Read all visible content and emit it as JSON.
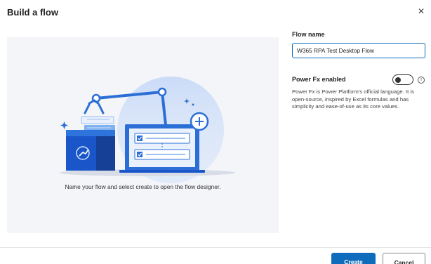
{
  "dialog": {
    "title": "Build a flow",
    "close_icon": "close-icon"
  },
  "illustration": {
    "caption": "Name your flow and select create to open the flow designer.",
    "icons": [
      "robot-arm-icon",
      "flow-box-icon",
      "laptop-icon",
      "plus-circle-icon",
      "sparkle-icon"
    ]
  },
  "form": {
    "flow_name_label": "Flow name",
    "flow_name_value": "W365 RPA Test Desktop Flow",
    "power_fx_label": "Power Fx enabled",
    "power_fx_enabled": false,
    "info_icon": "info-icon",
    "power_fx_description": "Power Fx is Power Platform's official language. It is open-source, inspired by Excel formulas and has simplicity and ease-of-use as its core values."
  },
  "footer": {
    "create_label": "Create",
    "cancel_label": "Cancel"
  },
  "colors": {
    "accent": "#0f6cbd",
    "panel_bg": "#f4f5f8",
    "illustration_blue": "#2b6fd6"
  }
}
